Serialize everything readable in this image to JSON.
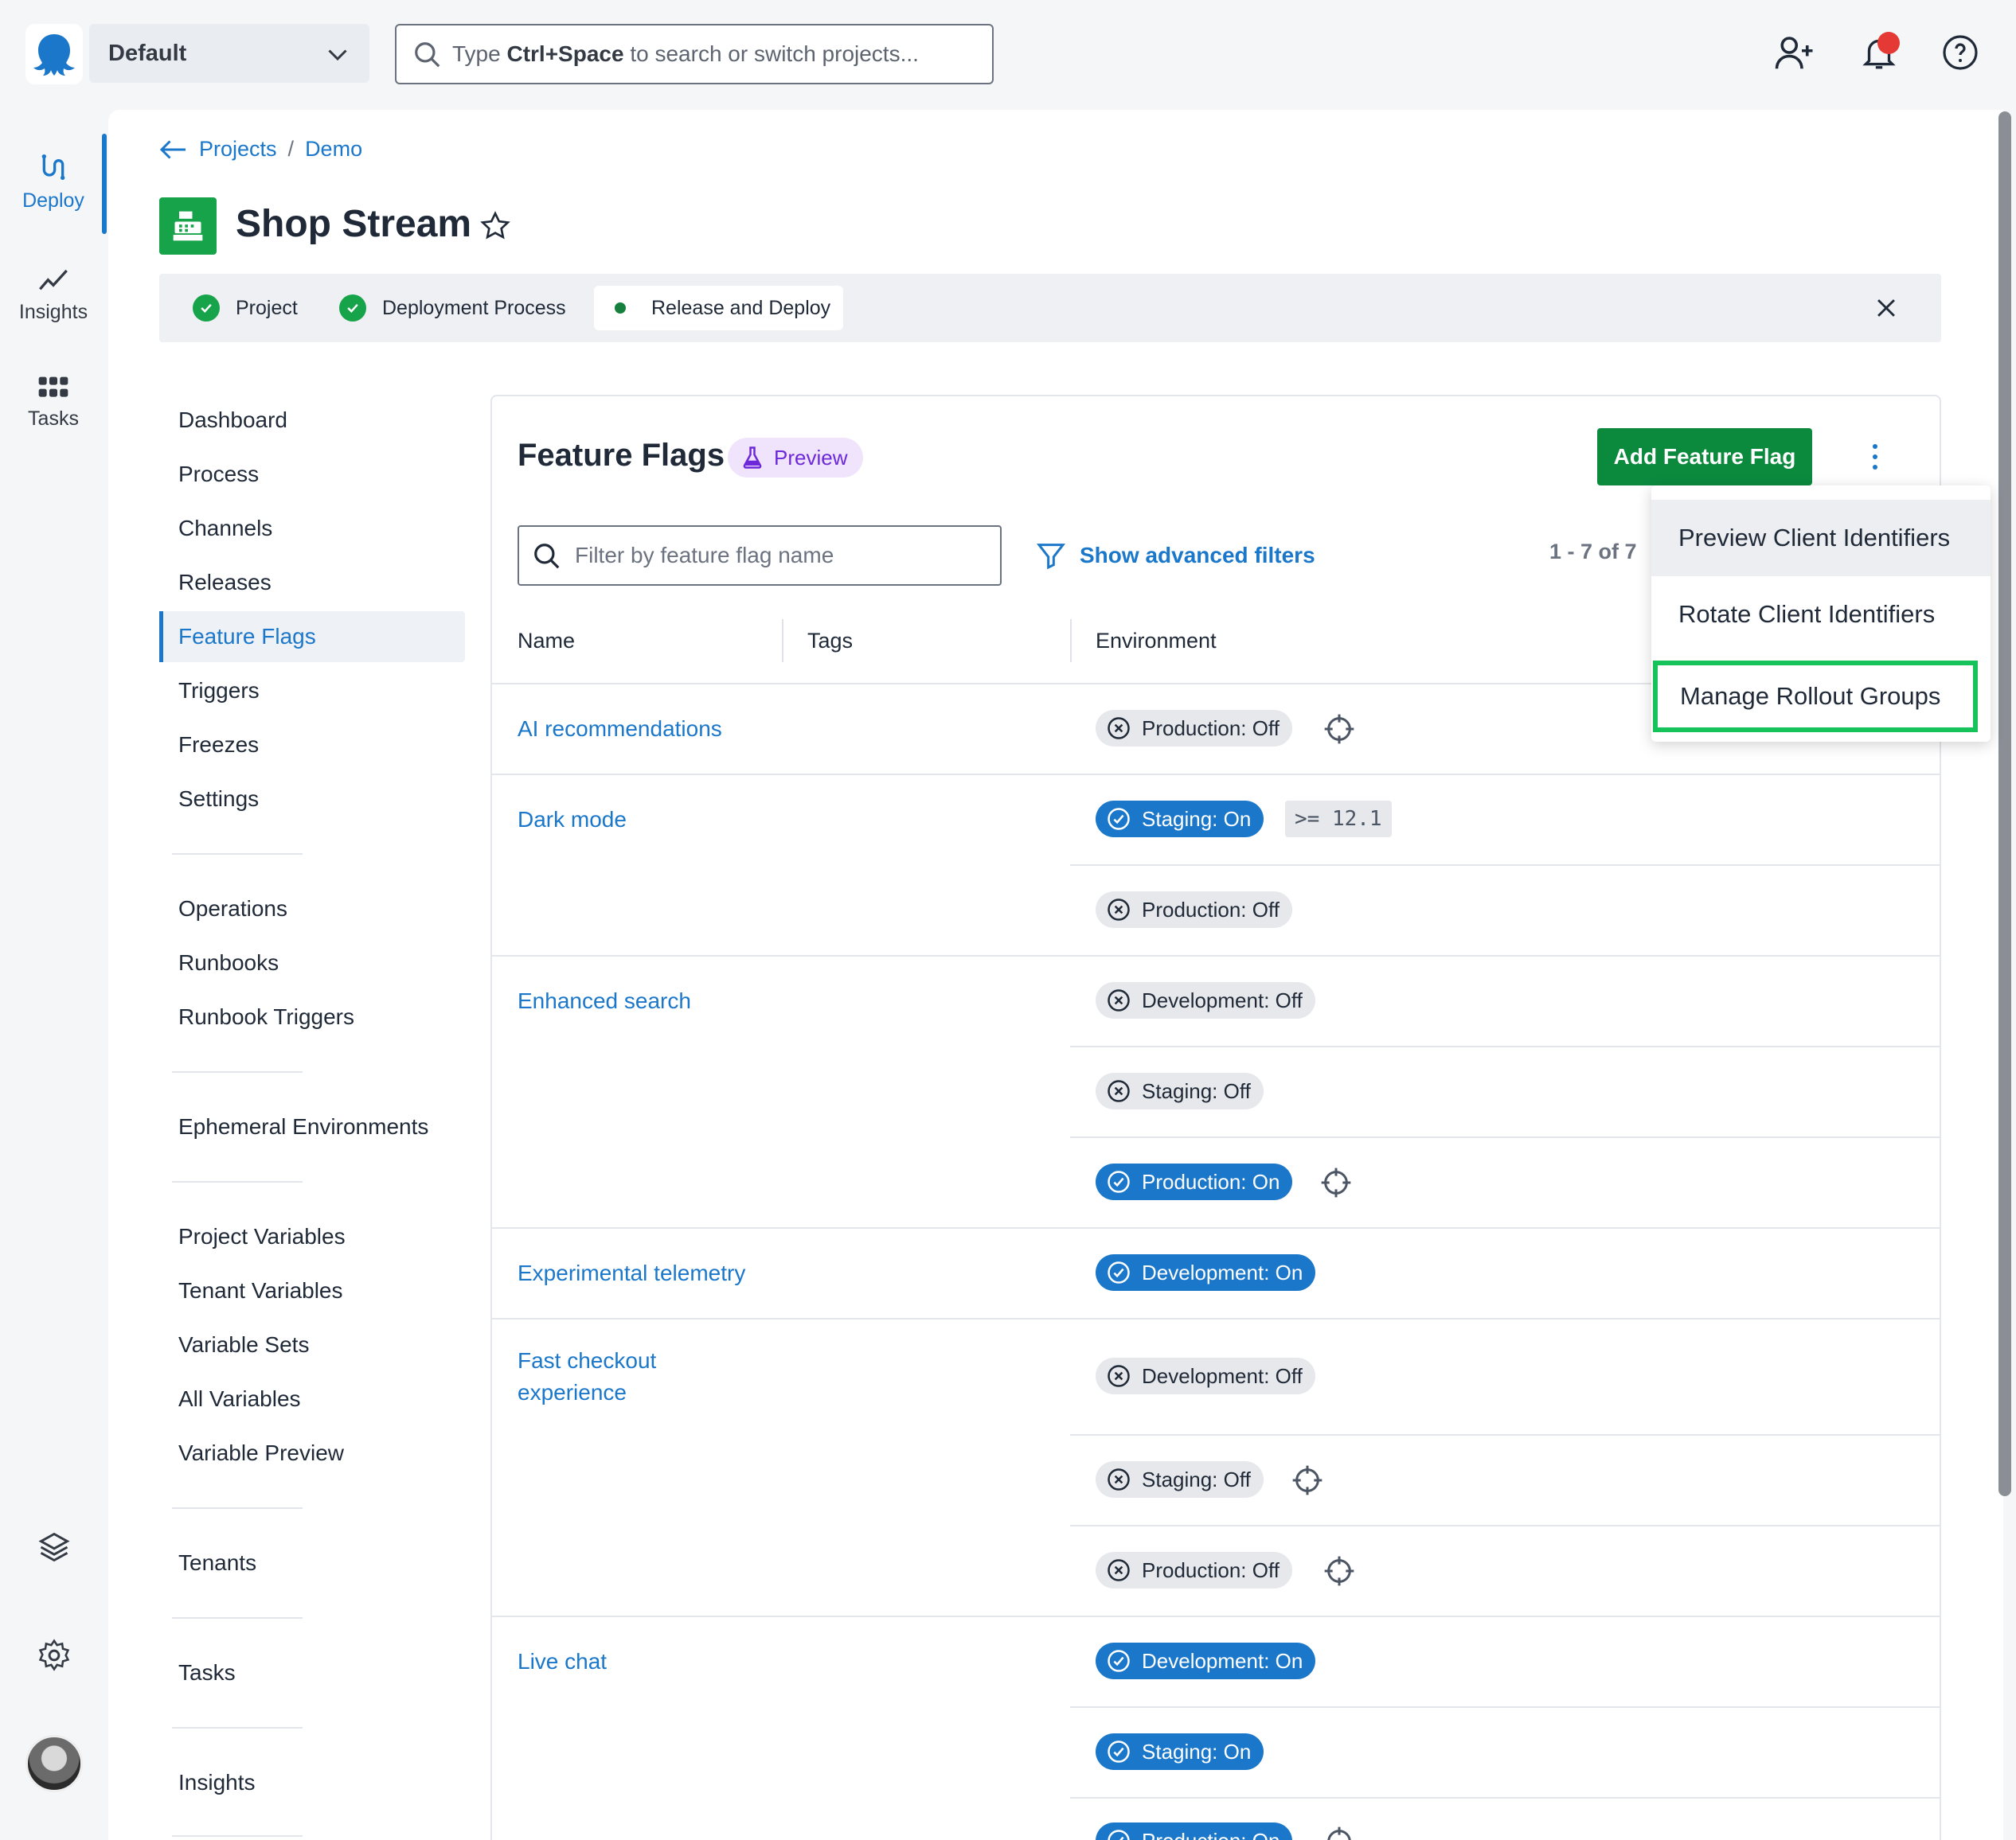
{
  "topbar": {
    "space": "Default",
    "search_pre": "Type ",
    "search_key": "Ctrl+Space",
    "search_post": " to search or switch projects..."
  },
  "rail": {
    "items": [
      {
        "label": "Deploy"
      },
      {
        "label": "Insights"
      },
      {
        "label": "Tasks"
      }
    ]
  },
  "breadcrumb": {
    "projects": "Projects",
    "sep": "/",
    "current": "Demo"
  },
  "project": {
    "title": "Shop Stream"
  },
  "steps": [
    {
      "label": "Project"
    },
    {
      "label": "Deployment Process"
    },
    {
      "label": "Release and Deploy"
    }
  ],
  "sidenav": {
    "groups": [
      [
        "Dashboard",
        "Process",
        "Channels",
        "Releases",
        "Feature Flags",
        "Triggers",
        "Freezes",
        "Settings"
      ],
      [
        "Operations",
        "Runbooks",
        "Runbook Triggers"
      ],
      [
        "Ephemeral Environments"
      ],
      [
        "Project Variables",
        "Tenant Variables",
        "Variable Sets",
        "All Variables",
        "Variable Preview"
      ],
      [
        "Tenants"
      ],
      [
        "Tasks"
      ],
      [
        "Insights"
      ]
    ],
    "active": "Feature Flags"
  },
  "feature_flags": {
    "title": "Feature Flags",
    "badge": "Preview",
    "add_button": "Add Feature Flag",
    "filter_placeholder": "Filter by feature flag name",
    "advanced_filters": "Show advanced filters",
    "pager": "1 - 7 of 7",
    "columns": [
      "Name",
      "Tags",
      "Environment"
    ],
    "flags": [
      {
        "name": "AI recommendations",
        "envs": [
          {
            "label": "Production: Off",
            "on": false,
            "target": true
          }
        ]
      },
      {
        "name": "Dark mode",
        "envs": [
          {
            "label": "Staging: On",
            "on": true,
            "rule": ">= 12.1"
          },
          {
            "label": "Production: Off",
            "on": false
          }
        ]
      },
      {
        "name": "Enhanced search",
        "envs": [
          {
            "label": "Development: Off",
            "on": false
          },
          {
            "label": "Staging: Off",
            "on": false
          },
          {
            "label": "Production: On",
            "on": true,
            "target": true
          }
        ]
      },
      {
        "name": "Experimental telemetry",
        "envs": [
          {
            "label": "Development: On",
            "on": true
          }
        ]
      },
      {
        "name_line1": "Fast checkout",
        "name_line2": "experience",
        "envs": [
          {
            "label": "Development: Off",
            "on": false
          },
          {
            "label": "Staging: Off",
            "on": false,
            "target": true
          },
          {
            "label": "Production: Off",
            "on": false,
            "target": true
          }
        ]
      },
      {
        "name": "Live chat",
        "envs": [
          {
            "label": "Development: On",
            "on": true
          },
          {
            "label": "Staging: On",
            "on": true
          },
          {
            "label": "Production: On",
            "on": true,
            "target": true
          }
        ]
      }
    ]
  },
  "menu": {
    "items": [
      "Preview Client Identifiers",
      "Rotate Client Identifiers",
      "Manage Rollout Groups"
    ]
  },
  "colors": {
    "accent": "#1a77ca",
    "primary_button": "#0b8a3e",
    "highlight": "#16c25a",
    "notification": "#e53935"
  },
  "icons": [
    "octopus-logo-icon",
    "chevron-down-icon",
    "search-icon",
    "add-user-icon",
    "bell-icon",
    "help-icon",
    "deploy-icon",
    "insights-icon",
    "tasks-icon",
    "layers-icon",
    "gear-icon",
    "star-icon",
    "close-icon",
    "filter-icon",
    "flask-icon",
    "kebab-icon",
    "check-circle-icon",
    "x-circle-icon",
    "target-icon",
    "cash-register-icon"
  ]
}
